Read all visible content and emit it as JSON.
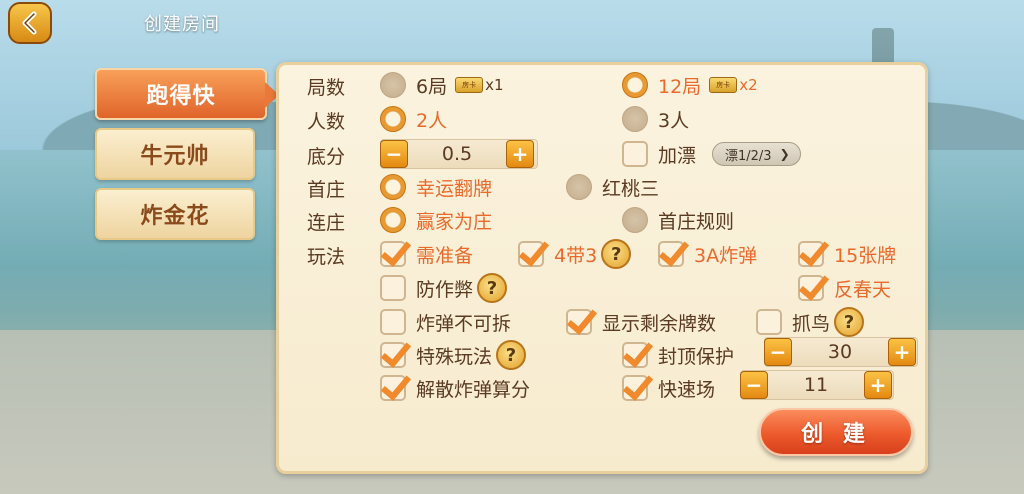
{
  "header": {
    "title": "创建房间"
  },
  "tabs": [
    {
      "label": "跑得快",
      "active": true
    },
    {
      "label": "牛元帅",
      "active": false
    },
    {
      "label": "炸金花",
      "active": false
    }
  ],
  "rows": {
    "rounds": {
      "label": "局数",
      "opt1": "6局",
      "opt1_mult": "x1",
      "opt2": "12局",
      "opt2_mult": "x2",
      "ticket_text": "房卡",
      "selected": "12局"
    },
    "players": {
      "label": "人数",
      "opt1": "2人",
      "opt2": "3人",
      "selected": "2人"
    },
    "base": {
      "label": "底分",
      "value": "0.5",
      "minus": "−",
      "plus": "+",
      "float_label": "加漂",
      "float_value": "漂1/2/3",
      "float_checked": false
    },
    "dealer": {
      "label": "首庄",
      "opt1": "幸运翻牌",
      "opt2": "红桃三",
      "selected": "幸运翻牌"
    },
    "continue": {
      "label": "连庄",
      "opt1": "赢家为庄",
      "opt2": "首庄规则",
      "selected": "赢家为庄"
    },
    "play": {
      "label": "玩法"
    }
  },
  "rules": {
    "need_prepare": {
      "label": "需准备",
      "checked": true
    },
    "four_three": {
      "label": "4带3",
      "checked": true
    },
    "three_a_bomb": {
      "label": "3A炸弹",
      "checked": true
    },
    "fifteen": {
      "label": "15张牌",
      "checked": true
    },
    "anti_cheat": {
      "label": "防作弊",
      "checked": false
    },
    "reverse": {
      "label": "反春天",
      "checked": true
    },
    "bomb_unsplit": {
      "label": "炸弹不可拆",
      "checked": false
    },
    "show_remain": {
      "label": "显示剩余牌数",
      "checked": true
    },
    "catch_bird": {
      "label": "抓鸟",
      "checked": false
    },
    "special": {
      "label": "特殊玩法",
      "checked": true
    },
    "cap": {
      "label": "封顶保护",
      "checked": true,
      "value": "30"
    },
    "dissolve": {
      "label": "解散炸弹算分",
      "checked": true
    },
    "fast": {
      "label": "快速场",
      "checked": true,
      "value": "11"
    }
  },
  "help_glyph": "?",
  "create_label": "创 建",
  "colors": {
    "accent": "#e96a2a",
    "text": "#5a3a22",
    "panel": "#f8eed5"
  }
}
